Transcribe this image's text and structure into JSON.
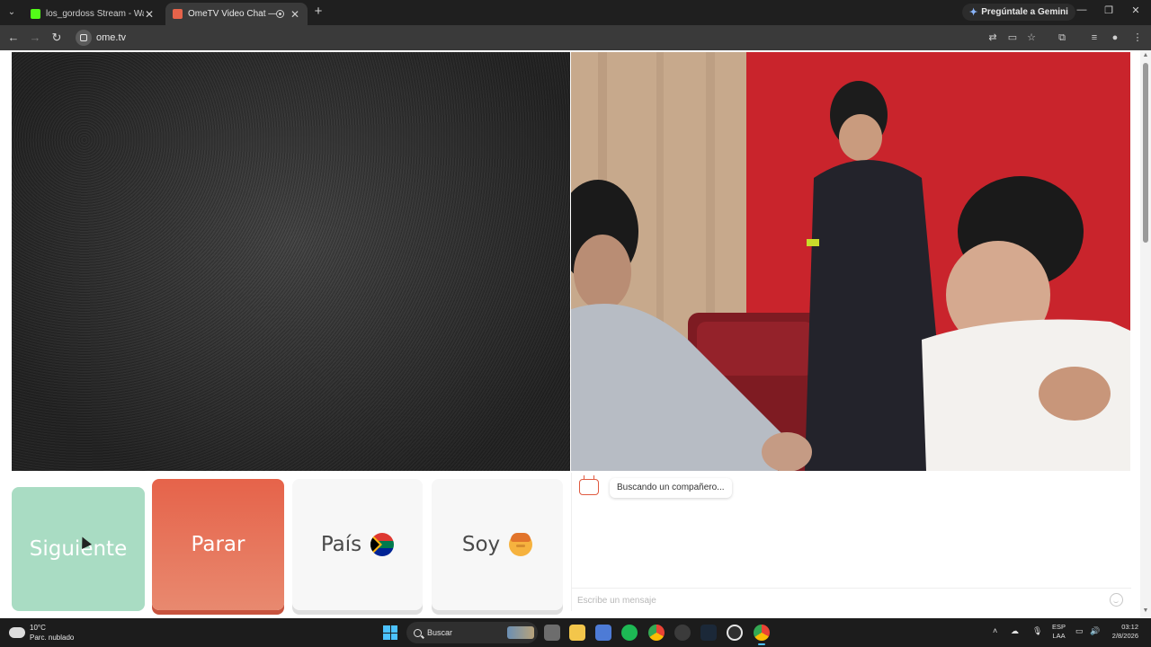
{
  "browser": {
    "tabs": [
      {
        "title": "los_gordoss Stream - Watch Live",
        "active": false,
        "favicon_color": "#53fc18"
      },
      {
        "title": "OmeTV Video Chat — OmeTV",
        "active": true,
        "favicon_color": "#e6634a"
      }
    ],
    "gemini_label": "Pregúntale a Gemini",
    "url": "ome.tv"
  },
  "controls": {
    "next_label": "Siguiente",
    "stop_label": "Parar",
    "country_label": "País",
    "country_flag": "south-africa-flag-icon",
    "gender_label": "Soy",
    "gender_icon": "boy-face-icon"
  },
  "chat": {
    "logo_text": "Ome TV",
    "status_message": "Buscando un compañero...",
    "input_placeholder": "Escribe un mensaje"
  },
  "taskbar": {
    "weather_temp": "10°C",
    "weather_desc": "Parc. nublado",
    "search_label": "Buscar",
    "lang_line1": "ESP",
    "lang_line2": "LAA",
    "time": "03:12",
    "date": "2/8/2026"
  },
  "colors": {
    "next_button": "#a9dcc3",
    "stop_button": "#e6634a",
    "neutral_button": "#f7f7f7",
    "chrome_dark": "#1f1f1f"
  }
}
